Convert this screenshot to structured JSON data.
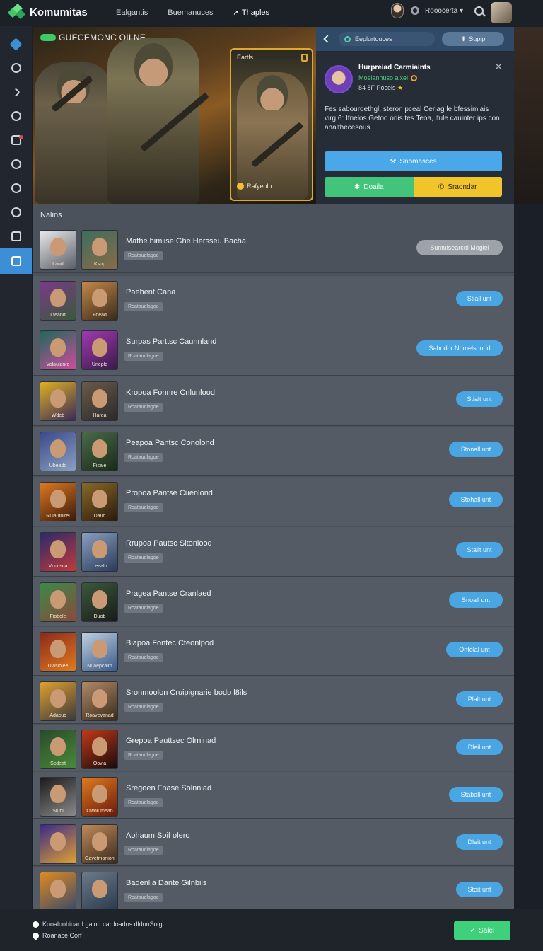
{
  "app": {
    "name": "Komumitas"
  },
  "nav": [
    {
      "label": "Ealgantis"
    },
    {
      "label": "Buemanuces"
    },
    {
      "label": "Thaples"
    }
  ],
  "account": {
    "label": "Rooocerta"
  },
  "hero": {
    "title": "GUECEMONC OILNE",
    "card_tag": "Eartls",
    "card_label": "Rafyeolu"
  },
  "panel": {
    "explore_label": "Eeplurtouces",
    "support_label": "Supip",
    "user_name": "Hurpreiad Carmiaints",
    "user_status": "Moeiannuso alxel",
    "user_stats": "84 8F Pocels",
    "description": "Fes sabouroethgl, steron pceal Ceriag le bfessimiais virg 6: Ifnelos Getoo oriis tes Teoa, lfule cauinter ips con analthecesous.",
    "primary_button": "Snomasces",
    "green_button": "Doaila",
    "yellow_button": "Sraondar"
  },
  "list": {
    "title": "Nalins",
    "rows": [
      {
        "name": "Mathe bimiise Ghe Hersseu Bacha",
        "sub": "Roataudlagoe",
        "button": "Suntuisearcol Mogiel",
        "thumb1": "Laud",
        "thumb2": "Ksup",
        "c1a": "#e8e8ea",
        "c1b": "#5b5f66",
        "c2a": "#3d6e5c",
        "c2b": "#8a6a4a"
      },
      {
        "name": "Paebent Cana",
        "sub": "Roataudlagoe",
        "button": "Stiall unt",
        "thumb1": "Lteand",
        "thumb2": "Fnead",
        "c1a": "#7a3a8a",
        "c1b": "#3a5a3a",
        "c2a": "#c48a4a",
        "c2b": "#3a2a1a"
      },
      {
        "name": "Surpas Parttsc Caunnland",
        "sub": "Roataudlagoe",
        "button": "Sabodor Nomelsound",
        "thumb1": "Volaulanre",
        "thumb2": "Uneplo",
        "c1a": "#1e6a5a",
        "c1b": "#d04aa0",
        "c2a": "#a03ab0",
        "c2b": "#3a1a4a"
      },
      {
        "name": "Kropoa Fonnre Cnlunlood",
        "sub": "Roataudlagoe",
        "button": "Stialt unt",
        "thumb1": "Wdeb",
        "thumb2": "Harea",
        "c1a": "#e0b020",
        "c1b": "#3a2a5a",
        "c2a": "#6a5a4a",
        "c2b": "#2a2a2a"
      },
      {
        "name": "Peapoa Pantsc Conolond",
        "sub": "Roataudlagoe",
        "button": "Stonall unt",
        "thumb1": "Ubeado",
        "thumb2": "Fisale",
        "c1a": "#3a4a8a",
        "c1b": "#8aa0c0",
        "c2a": "#4a6a4a",
        "c2b": "#1a2a1a"
      },
      {
        "name": "Propoa Pantse Cuenlond",
        "sub": "Roataudlagoe",
        "button": "Stohall unt",
        "thumb1": "Rulautoirel",
        "thumb2": "Daud",
        "c1a": "#e07a20",
        "c1b": "#3a1a0a",
        "c2a": "#8a6a2a",
        "c2b": "#2a1a0a"
      },
      {
        "name": "Rrupoa Pautsc Sitonlood",
        "sub": "Roataudlagoe",
        "button": "Stailt unt",
        "thumb1": "Vnucsca",
        "thumb2": "Leaalo",
        "c1a": "#2a2a6a",
        "c1b": "#c03a3a",
        "c2a": "#8aa0c0",
        "c2b": "#2a3a5a"
      },
      {
        "name": "Pragea Pantse Cranlaed",
        "sub": "Roataudlagoe",
        "button": "Snoall unt",
        "thumb1": "Fiobole",
        "thumb2": "Duob",
        "c1a": "#3a8a4a",
        "c1b": "#8a4a3a",
        "c2a": "#3a5a3a",
        "c2b": "#1a1a1a"
      },
      {
        "name": "Biapoa Fontec Cteonlpod",
        "sub": "Roataudlagoe",
        "button": "Ontolal unt",
        "thumb1": "Dlasiblee",
        "thumb2": "Nuaepcalm",
        "c1a": "#8a2a1a",
        "c1b": "#e07a20",
        "c2a": "#c0d0e0",
        "c2b": "#3a5a8a"
      },
      {
        "name": "Sronmoolon Cruipignarie bodo l8ils",
        "sub": "Roataudlagoe",
        "button": "Plalt unt",
        "thumb1": "Adacuc",
        "thumb2": "Roavevanad",
        "c1a": "#e0a030",
        "c1b": "#3a3a3a",
        "c2a": "#b08a6a",
        "c2b": "#3a2a1a"
      },
      {
        "name": "Grepoa Pauttsec Olrninad",
        "sub": "Roataudlagoe",
        "button": "Dleil unt",
        "thumb1": "Scdeat",
        "thumb2": "Oovia",
        "c1a": "#2a4a2a",
        "c1b": "#4a8a3a",
        "c2a": "#c03a1a",
        "c2b": "#1a0a0a"
      },
      {
        "name": "Sregoen Fnase Solnniad",
        "sub": "Roataudlagoe",
        "button": "Staball unt",
        "thumb1": "Slubl",
        "thumb2": "Owolumean",
        "c1a": "#1a1a1a",
        "c1b": "#8a8a8a",
        "c2a": "#e07a20",
        "c2b": "#6a1a0a"
      },
      {
        "name": "Aohaum Soif olero",
        "sub": "Roataudlagoe",
        "button": "Dleit unt",
        "thumb1": "",
        "thumb2": "Gavetmaniont",
        "c1a": "#3a2a8a",
        "c1b": "#e0a030",
        "c2a": "#c08a5a",
        "c2b": "#3a2a1a"
      },
      {
        "name": "Badenlia Dante Gilnbils",
        "sub": "Roataudlagoe",
        "button": "Stoit unt",
        "thumb1": "",
        "thumb2": "",
        "c1a": "#e08a20",
        "c1b": "#3a4a6a",
        "c2a": "#6a7a8a",
        "c2b": "#2a3a4a"
      }
    ]
  },
  "footer": {
    "line1": "Kooaloobioar I gaind cardoados dldonSolg",
    "line2": "Roanace Corf",
    "save": "Saiei"
  }
}
